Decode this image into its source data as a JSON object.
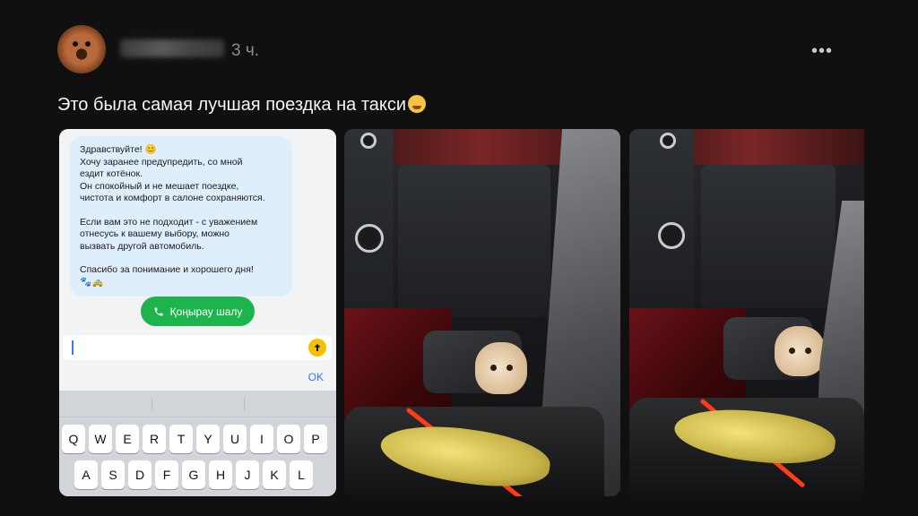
{
  "post": {
    "username": "aliya_jolldas",
    "time": "3 ч.",
    "more": "•••",
    "caption": "Это была самая лучшая поездка на такси"
  },
  "chat": {
    "message": {
      "p1_line1": "Здравствуйте! 😊",
      "p1_line2": "Хочу заранее предупредить, со мной",
      "p1_line3": "ездит котёнок.",
      "p1_line4": "Он спокойный и не мешает поездке,",
      "p1_line5": "чистота и комфорт в салоне сохраняются.",
      "p2_line1": "Если вам это не подходит - с уважением",
      "p2_line2": "отнесусь к вашему выбору, можно",
      "p2_line3": "вызвать другой автомобиль.",
      "p3_line1": "Спасибо за понимание и хорошего дня!",
      "p3_line2": "🐾🚕"
    },
    "call_button": "Қоңырау шалу",
    "ok": "OK"
  },
  "keyboard": {
    "row1": [
      "Q",
      "W",
      "E",
      "R",
      "T",
      "Y",
      "U",
      "I",
      "O",
      "P"
    ],
    "row2": [
      "A",
      "S",
      "D",
      "F",
      "G",
      "H",
      "J",
      "K",
      "L"
    ]
  },
  "icons": {
    "more": "more-dots-icon",
    "phone": "phone-icon",
    "send": "arrow-up-icon",
    "emoji": "crying-face-emoji"
  },
  "colors": {
    "background": "#101010",
    "call_button": "#1eb44d",
    "send_button": "#f4c100",
    "ok_link": "#2f7be8",
    "bubble": "#dfeefb"
  }
}
